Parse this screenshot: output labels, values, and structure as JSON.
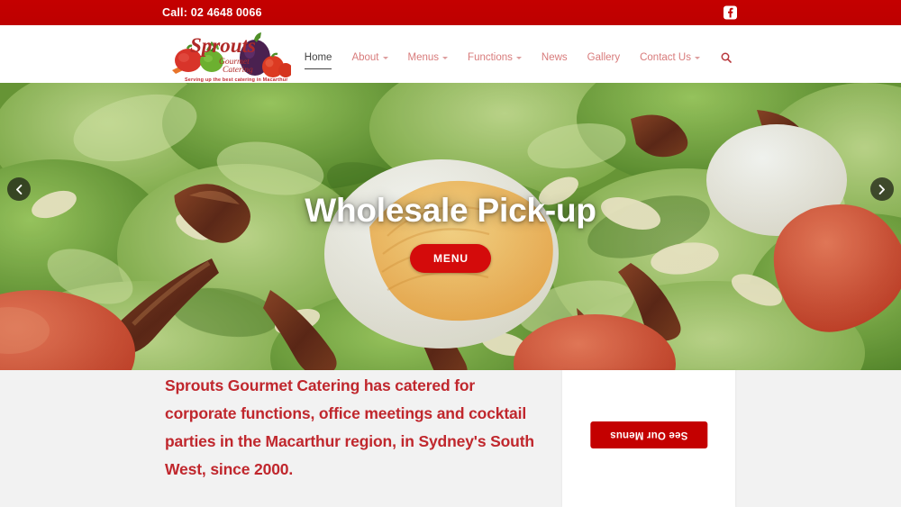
{
  "topbar": {
    "phone": "Call: 02 4648 0066",
    "social_icon": "facebook-icon",
    "background_color": "#c20000"
  },
  "header": {
    "logo": {
      "name": "Sprouts",
      "subtitle_line1": "Gourmet",
      "subtitle_line2": "Catering",
      "tagline": "Serving up the best catering in Macarthur"
    },
    "nav": [
      {
        "label": "Home",
        "active": true,
        "has_caret": false
      },
      {
        "label": "About",
        "active": false,
        "has_caret": true
      },
      {
        "label": "Menus",
        "active": false,
        "has_caret": true
      },
      {
        "label": "Functions",
        "active": false,
        "has_caret": true
      },
      {
        "label": "News",
        "active": false,
        "has_caret": false
      },
      {
        "label": "Gallery",
        "active": false,
        "has_caret": false
      },
      {
        "label": "Contact Us",
        "active": false,
        "has_caret": true
      }
    ],
    "search_icon": "search-icon"
  },
  "hero": {
    "title": "Wholesale Pick-up",
    "button_label": "MENU",
    "prev_icon": "chevron-left-icon",
    "next_icon": "chevron-right-icon",
    "image_description": "Caesar salad with lettuce, bacon, boiled egg, shaved parmesan and tomato"
  },
  "main": {
    "intro_paragraph": "Sprouts Gourmet Catering has catered for corporate functions, office meetings and cocktail parties in the Macarthur region, in Sydney's South West, since 2000.",
    "side_card": {
      "button_label": "See Our Menus",
      "button_color": "#c40000"
    }
  },
  "colors": {
    "brand_red": "#c20000",
    "text_red": "#c0272d",
    "nav_link": "#d87b7b",
    "page_background": "#f2f2f2"
  }
}
